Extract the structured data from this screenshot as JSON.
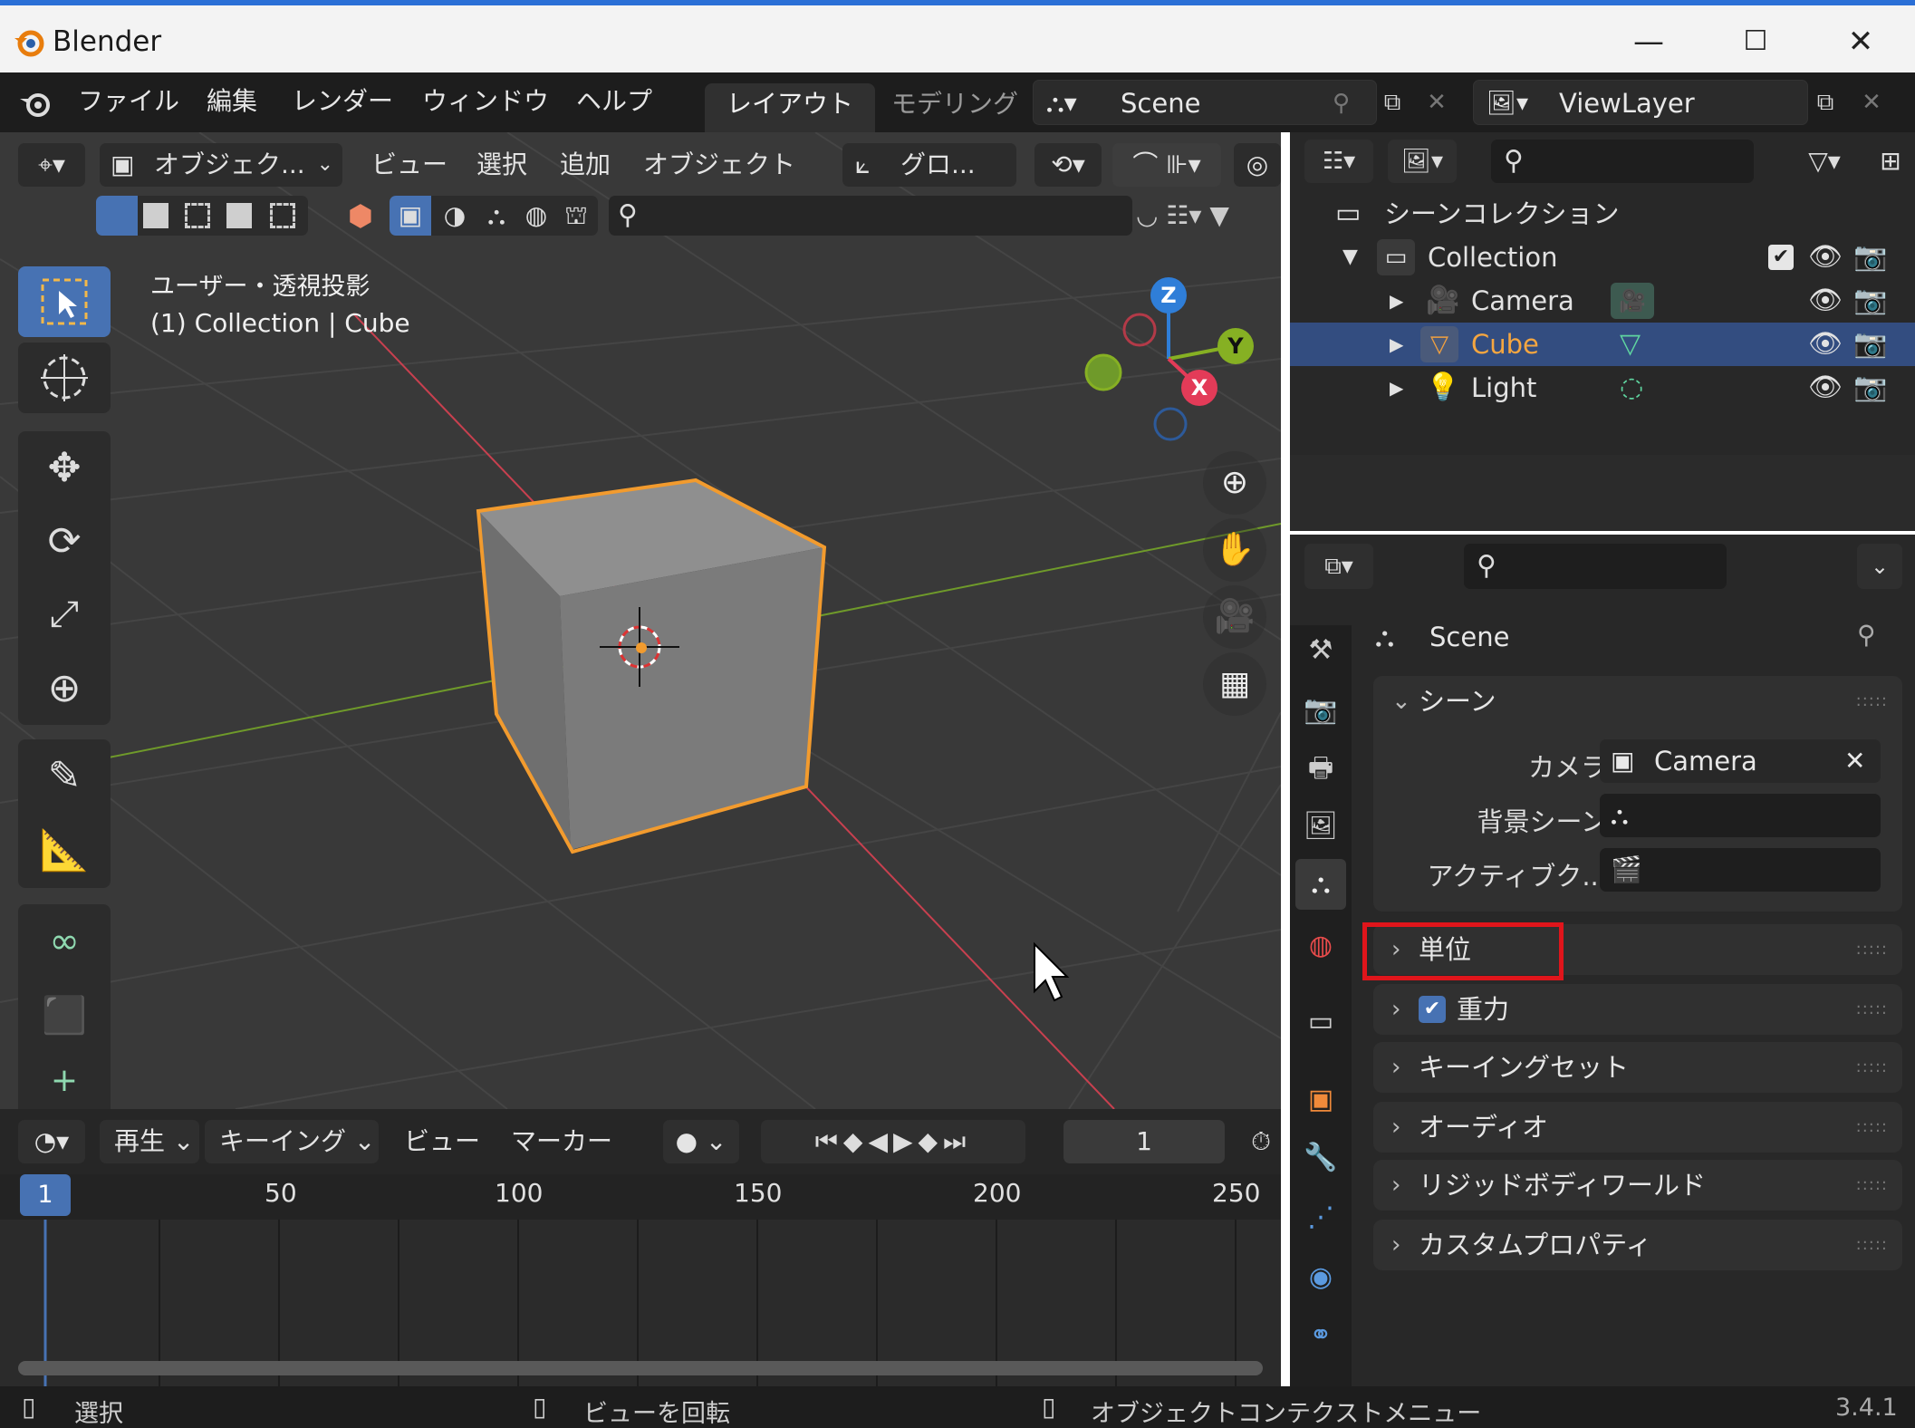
{
  "window": {
    "title": "Blender",
    "minimize": "—",
    "maximize": "☐",
    "close": "✕"
  },
  "topbar": {
    "menus": [
      "ファイル",
      "編集",
      "レンダー",
      "ウィンドウ",
      "ヘルプ"
    ],
    "tabs": [
      "レイアウト",
      "モデリング"
    ],
    "active_tab": "レイアウト",
    "scene": "Scene",
    "view_layer": "ViewLayer"
  },
  "viewport": {
    "header": {
      "mode": "オブジェク...",
      "menus": [
        "ビュー",
        "選択",
        "追加",
        "オブジェクト"
      ],
      "transform_orientation": "グロ..."
    },
    "overlay_text": {
      "view": "ユーザー・透視投影",
      "context": "(1) Collection | Cube"
    },
    "gizmo": {
      "x": "X",
      "y": "Y",
      "z": "Z"
    },
    "colors": {
      "background": "#393939",
      "selected_outline": "#f29b2e",
      "x_axis": "#c8404f",
      "y_axis": "#6f9a2a",
      "active_tool": "#4772b3"
    }
  },
  "outliner": {
    "root": "シーンコレクション",
    "collection": "Collection",
    "items": [
      {
        "label": "Camera",
        "selected": false
      },
      {
        "label": "Cube",
        "selected": true
      },
      {
        "label": "Light",
        "selected": false
      }
    ]
  },
  "properties": {
    "context": "Scene",
    "scene_panel": {
      "title": "シーン",
      "camera_label": "カメラ",
      "camera_value": "Camera",
      "background_label": "背景シーン",
      "active_clip_label": "アクティブク..."
    },
    "collapsed_panels": [
      {
        "label": "単位",
        "highlighted": true
      },
      {
        "label": "重力",
        "checkbox": true
      },
      {
        "label": "キーイングセット"
      },
      {
        "label": "オーディオ"
      },
      {
        "label": "リジッドボディワールド"
      },
      {
        "label": "カスタムプロパティ"
      }
    ],
    "highlight_color": "#e0151b"
  },
  "timeline": {
    "menus": {
      "playback": "再生",
      "keying": "キーイング",
      "view": "ビュー",
      "marker": "マーカー"
    },
    "current_frame": "1",
    "current_frame_marker": "1",
    "frame_labels": [
      "50",
      "100",
      "150",
      "200",
      "250"
    ]
  },
  "statusbar": {
    "select": "選択",
    "rotate_view": "ビューを回転",
    "context_menu": "オブジェクトコンテクストメニュー",
    "version": "3.4.1"
  }
}
